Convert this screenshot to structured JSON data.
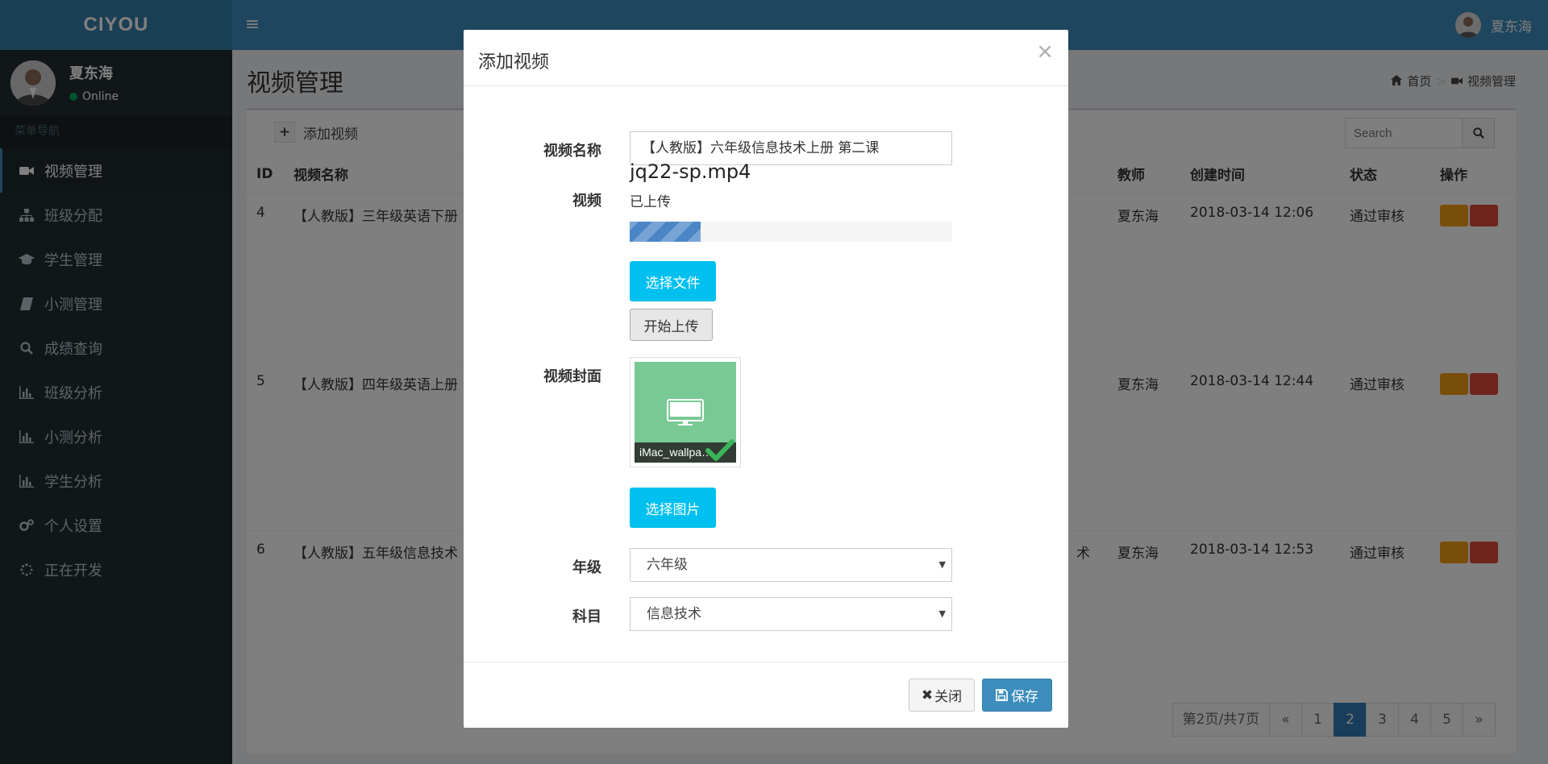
{
  "app": {
    "logo": "CIYOU",
    "user_name": "夏东海",
    "user_status": "Online"
  },
  "sidebar": {
    "menu_header": "菜单导航",
    "items": [
      {
        "label": "视频管理",
        "icon": "video-camera-icon"
      },
      {
        "label": "班级分配",
        "icon": "sitemap-icon"
      },
      {
        "label": "学生管理",
        "icon": "graduation-cap-icon"
      },
      {
        "label": "小测管理",
        "icon": "book-icon"
      },
      {
        "label": "成绩查询",
        "icon": "search-icon"
      },
      {
        "label": "班级分析",
        "icon": "bar-chart-icon"
      },
      {
        "label": "小测分析",
        "icon": "bar-chart-icon"
      },
      {
        "label": "学生分析",
        "icon": "bar-chart-icon"
      },
      {
        "label": "个人设置",
        "icon": "gears-icon"
      },
      {
        "label": "正在开发",
        "icon": "spinner-icon"
      }
    ]
  },
  "page": {
    "title": "视频管理",
    "breadcrumb": {
      "home": "首页",
      "current": "视频管理"
    },
    "add_label": "添加视频",
    "search_placeholder": "Search"
  },
  "table": {
    "columns": {
      "id": "ID",
      "name": "视频名称",
      "teacher": "教师",
      "created": "创建时间",
      "status": "状态",
      "actions": "操作"
    },
    "rows": [
      {
        "id": "4",
        "name": "【人教版】三年级英语下册",
        "extra": "",
        "teacher": "夏东海",
        "created": "2018-03-14 12:06",
        "status": "通过审核"
      },
      {
        "id": "5",
        "name": "【人教版】四年级英语上册",
        "extra": "",
        "teacher": "夏东海",
        "created": "2018-03-14 12:44",
        "status": "通过审核"
      },
      {
        "id": "6",
        "name": "【人教版】五年级信息技术",
        "extra": "术",
        "teacher": "夏东海",
        "created": "2018-03-14 12:53",
        "status": "通过审核"
      }
    ]
  },
  "pagination": {
    "info": "第2页/共7页",
    "prev": "«",
    "pages": [
      "1",
      "2",
      "3",
      "4",
      "5"
    ],
    "current": "2",
    "next": "»"
  },
  "modal": {
    "title": "添加视频",
    "close_glyph": "×",
    "fields": {
      "name_label": "视频名称",
      "name_value": "【人教版】六年级信息技术上册 第二课",
      "video_label": "视频",
      "file_name": "jq22-sp.mp4",
      "file_status": "已上传",
      "progress": 0.22,
      "choose_file": "选择文件",
      "start_upload": "开始上传",
      "cover_label": "视频封面",
      "cover_caption": "iMac_wallpa…",
      "choose_image": "选择图片",
      "grade_label": "年级",
      "grade_value": "六年级",
      "subject_label": "科目",
      "subject_value": "信息技术"
    },
    "footer": {
      "close_label": "关闭",
      "save_label": "保存"
    }
  },
  "colors": {
    "header": "#3c8dbc",
    "logo_bg": "#367fa9",
    "sidebar": "#222d32",
    "accent": "#00c0ef",
    "warning": "#f39c12",
    "danger": "#dd4b39",
    "success": "#00a65a"
  }
}
